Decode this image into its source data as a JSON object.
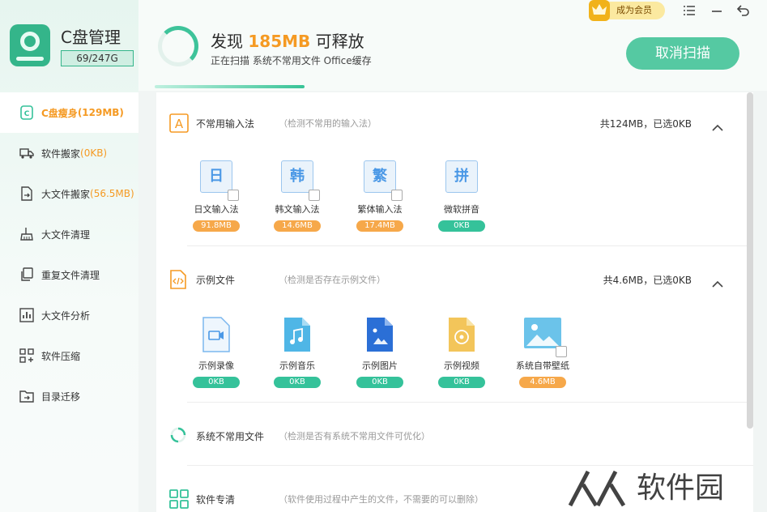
{
  "app": {
    "title": "C盘管理",
    "usage": "69/247G"
  },
  "sidebar": {
    "items": [
      {
        "label": "C盘瘦身",
        "count": "(129MB)",
        "icon": "disk-slim-icon",
        "active": true
      },
      {
        "label": "软件搬家",
        "count": "(0KB)",
        "icon": "truck-icon",
        "active": false
      },
      {
        "label": "大文件搬家",
        "count": "(56.5MB)",
        "icon": "file-move-icon",
        "active": false
      },
      {
        "label": "大文件清理",
        "count": "",
        "icon": "broom-icon",
        "active": false
      },
      {
        "label": "重复文件清理",
        "count": "",
        "icon": "duplicate-icon",
        "active": false
      },
      {
        "label": "大文件分析",
        "count": "",
        "icon": "analysis-icon",
        "active": false
      },
      {
        "label": "软件压缩",
        "count": "",
        "icon": "compress-icon",
        "active": false
      },
      {
        "label": "目录迁移",
        "count": "",
        "icon": "folder-move-icon",
        "active": false
      }
    ]
  },
  "header": {
    "found_prefix": "发现 ",
    "found_amount": "185MB",
    "found_suffix": " 可释放",
    "scan_status": "正在扫描 系统不常用文件 Office缓存",
    "cancel_label": "取消扫描",
    "vip_label": "成为会员"
  },
  "sections": [
    {
      "title": "不常用输入法",
      "desc": "（检测不常用的输入法）",
      "total": "共124MB，已选0KB",
      "items": [
        {
          "glyph": "日",
          "label": "日文输入法",
          "size": "91.8MB",
          "tone": "orange"
        },
        {
          "glyph": "韩",
          "label": "韩文输入法",
          "size": "14.6MB",
          "tone": "orange"
        },
        {
          "glyph": "繁",
          "label": "繁体输入法",
          "size": "17.4MB",
          "tone": "orange"
        },
        {
          "glyph": "拼",
          "label": "微软拼音",
          "size": "0KB",
          "tone": "green"
        }
      ]
    },
    {
      "title": "示例文件",
      "desc": "（检测是否存在示例文件）",
      "total": "共4.6MB，已选0KB",
      "items": [
        {
          "label": "示例录像",
          "size": "0KB",
          "tone": "green",
          "icon": "video-file-icon"
        },
        {
          "label": "示例音乐",
          "size": "0KB",
          "tone": "green",
          "icon": "music-file-icon"
        },
        {
          "label": "示例图片",
          "size": "0KB",
          "tone": "green",
          "icon": "image-file-icon"
        },
        {
          "label": "示例视频",
          "size": "0KB",
          "tone": "green",
          "icon": "play-file-icon"
        },
        {
          "label": "系统自带壁纸",
          "size": "4.6MB",
          "tone": "orange",
          "icon": "wallpaper-icon"
        }
      ]
    },
    {
      "title": "系统不常用文件",
      "desc": "（检测是否有系统不常用文件可优化）"
    },
    {
      "title": "软件专清",
      "desc": "（软件使用过程中产生的文件，不需要的可以删除）"
    }
  ],
  "colors": {
    "accent": "#35c29a",
    "orange": "#f59a23"
  }
}
